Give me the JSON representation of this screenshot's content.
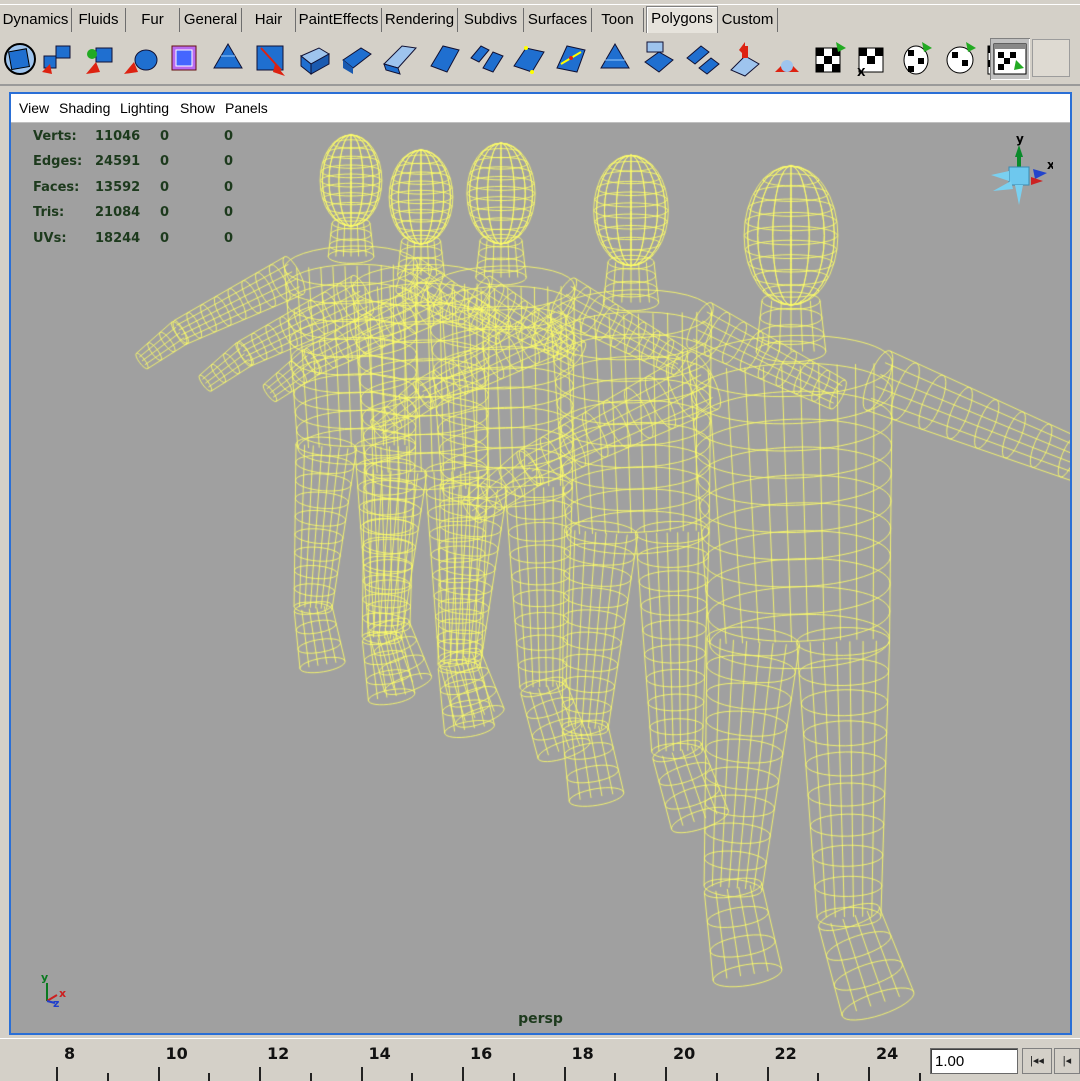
{
  "shelf": {
    "tabs": [
      {
        "label": "Dynamics"
      },
      {
        "label": "Fluids"
      },
      {
        "label": "Fur"
      },
      {
        "label": "General"
      },
      {
        "label": "Hair"
      },
      {
        "label": "PaintEffects"
      },
      {
        "label": "Rendering"
      },
      {
        "label": "Subdivs"
      },
      {
        "label": "Surfaces"
      },
      {
        "label": "Toon"
      },
      {
        "label": "Polygons"
      },
      {
        "label": "Custom"
      }
    ],
    "active_tab": "Polygons"
  },
  "toolbar": {
    "icons": [
      "polygon-select-icon",
      "combine-icon",
      "separate-icon",
      "extract-icon",
      "smooth-proxy-icon",
      "subdivide-icon",
      "split-polygon-icon",
      "extrude-face-icon",
      "extrude-edge-icon",
      "bevel-icon",
      "merge-vertices-icon",
      "bridge-icon",
      "append-polygon-icon",
      "wedge-faces-icon",
      "poke-faces-icon",
      "duplicate-face-icon",
      "cut-faces-icon",
      "chip-off-icon",
      "sculpt-icon",
      "planar-map-icon",
      "automatic-map-icon",
      "cylindrical-map-icon",
      "spherical-map-icon",
      "checker-map-icon",
      "uv-texture-editor-icon"
    ],
    "accent": "#1f6fd0"
  },
  "panel_menu": {
    "items": [
      "View",
      "Shading",
      "Lighting",
      "Show",
      "Panels"
    ]
  },
  "hud": {
    "rows": [
      {
        "label": "Verts:",
        "v1": "11046",
        "v2": "0",
        "v3": "0"
      },
      {
        "label": "Edges:",
        "v1": "24591",
        "v2": "0",
        "v3": "0"
      },
      {
        "label": "Faces:",
        "v1": "13592",
        "v2": "0",
        "v3": "0"
      },
      {
        "label": "Tris:",
        "v1": "21084",
        "v2": "0",
        "v3": "0"
      },
      {
        "label": "UVs:",
        "v1": "18244",
        "v2": "0",
        "v3": "0"
      }
    ]
  },
  "viewport": {
    "camera": "persp",
    "background": "#a0a0a0",
    "wireframe_color": "#ffff66",
    "view_cube": {
      "axes": [
        "y",
        "x"
      ]
    },
    "axis_indicator": {
      "axes": [
        "y",
        "z",
        "x"
      ]
    }
  },
  "time_slider": {
    "ticks": [
      "8",
      "10",
      "12",
      "14",
      "16",
      "18",
      "20",
      "22",
      "24"
    ],
    "current_frame": "1.00",
    "step_back_label": "|◂◂",
    "prev_label": "|◂"
  }
}
